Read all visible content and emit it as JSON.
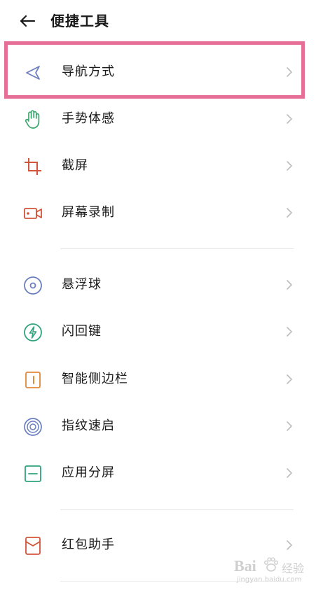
{
  "header": {
    "title": "便捷工具"
  },
  "items": [
    {
      "label": "导航方式",
      "icon": "navigation-arrow-icon",
      "color": "#6a7fbf"
    },
    {
      "label": "手势体感",
      "icon": "hand-gesture-icon",
      "color": "#3aa76d"
    },
    {
      "label": "截屏",
      "icon": "crop-screenshot-icon",
      "color": "#d2543a"
    },
    {
      "label": "屏幕录制",
      "icon": "video-record-icon",
      "color": "#d2543a"
    },
    {
      "label": "悬浮球",
      "icon": "floating-ball-icon",
      "color": "#6a7fbf"
    },
    {
      "label": "闪回键",
      "icon": "flashback-bolt-icon",
      "color": "#2fa37c"
    },
    {
      "label": "智能侧边栏",
      "icon": "smart-sidebar-icon",
      "color": "#e0893b"
    },
    {
      "label": "指纹速启",
      "icon": "fingerprint-icon",
      "color": "#6a7fbf"
    },
    {
      "label": "应用分屏",
      "icon": "split-screen-icon",
      "color": "#2fa37c"
    },
    {
      "label": "红包助手",
      "icon": "red-envelope-icon",
      "color": "#d2543a"
    }
  ],
  "highlight_color": "#e56f96",
  "watermark": {
    "brand": "Bai",
    "text": "经验",
    "url": "jingyan.baidu.com"
  }
}
